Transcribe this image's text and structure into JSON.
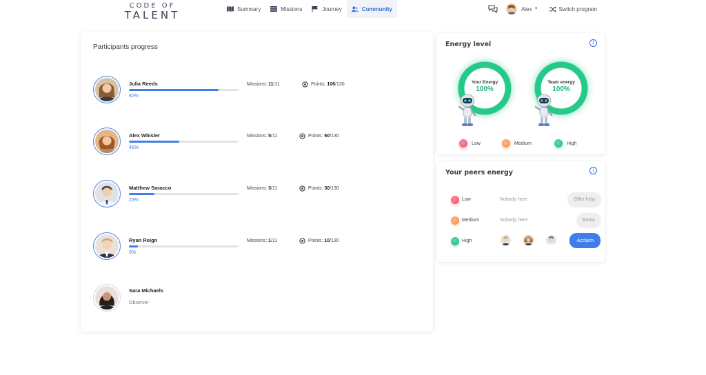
{
  "brand": {
    "line1": "CODE OF",
    "line2": "TALENT"
  },
  "nav": [
    {
      "label": "Summary",
      "icon": "map-icon",
      "active": false
    },
    {
      "label": "Missions",
      "icon": "list-icon",
      "active": false
    },
    {
      "label": "Journey",
      "icon": "flag-icon",
      "active": false
    },
    {
      "label": "Community",
      "icon": "people-icon",
      "active": true
    }
  ],
  "user": {
    "name": "Alex",
    "switch_label": "Switch program"
  },
  "progress": {
    "title": "Participants progress",
    "participants": [
      {
        "name": "Julia Reeds",
        "percent_label": "82%",
        "progress": 0.82,
        "missions_label": "Missions:",
        "missions_done": "11",
        "missions_total": "/11",
        "points_label": "Points:",
        "points": "106",
        "points_total": "/130"
      },
      {
        "name": "Alex Whisler",
        "percent_label": "46%",
        "progress": 0.46,
        "missions_label": "Missions:",
        "missions_done": "5",
        "missions_total": "/11",
        "points_label": "Points:",
        "points": "60",
        "points_total": "/130"
      },
      {
        "name": "Matthew Saracco",
        "percent_label": "23%",
        "progress": 0.23,
        "missions_label": "Missions:",
        "missions_done": "3",
        "missions_total": "/11",
        "points_label": "Points:",
        "points": "30",
        "points_total": "/130"
      },
      {
        "name": "Ryan Reign",
        "percent_label": "8%",
        "progress": 0.08,
        "missions_label": "Missions:",
        "missions_done": "1",
        "missions_total": "/11",
        "points_label": "Points:",
        "points": "10",
        "points_total": "/130"
      },
      {
        "name": "Sara Michaels",
        "role": "Observer"
      }
    ]
  },
  "energy": {
    "title": "Energy level",
    "your_label": "Your Energy",
    "your_value": "100%",
    "team_label": "Team energy",
    "team_value": "100%",
    "legend": {
      "low": "Low",
      "medium": "Medium",
      "high": "High"
    },
    "colors": {
      "low": "#ee4d64",
      "medium": "#f58b45",
      "high": "#1fb57a"
    }
  },
  "peers": {
    "title": "Your peers energy",
    "rows": [
      {
        "level": "Low",
        "empty_text": "Nobody here",
        "button": "Offer help"
      },
      {
        "level": "Medium",
        "empty_text": "Nobody here",
        "button": "Boost"
      },
      {
        "level": "High",
        "button": "Acclaim"
      }
    ]
  }
}
